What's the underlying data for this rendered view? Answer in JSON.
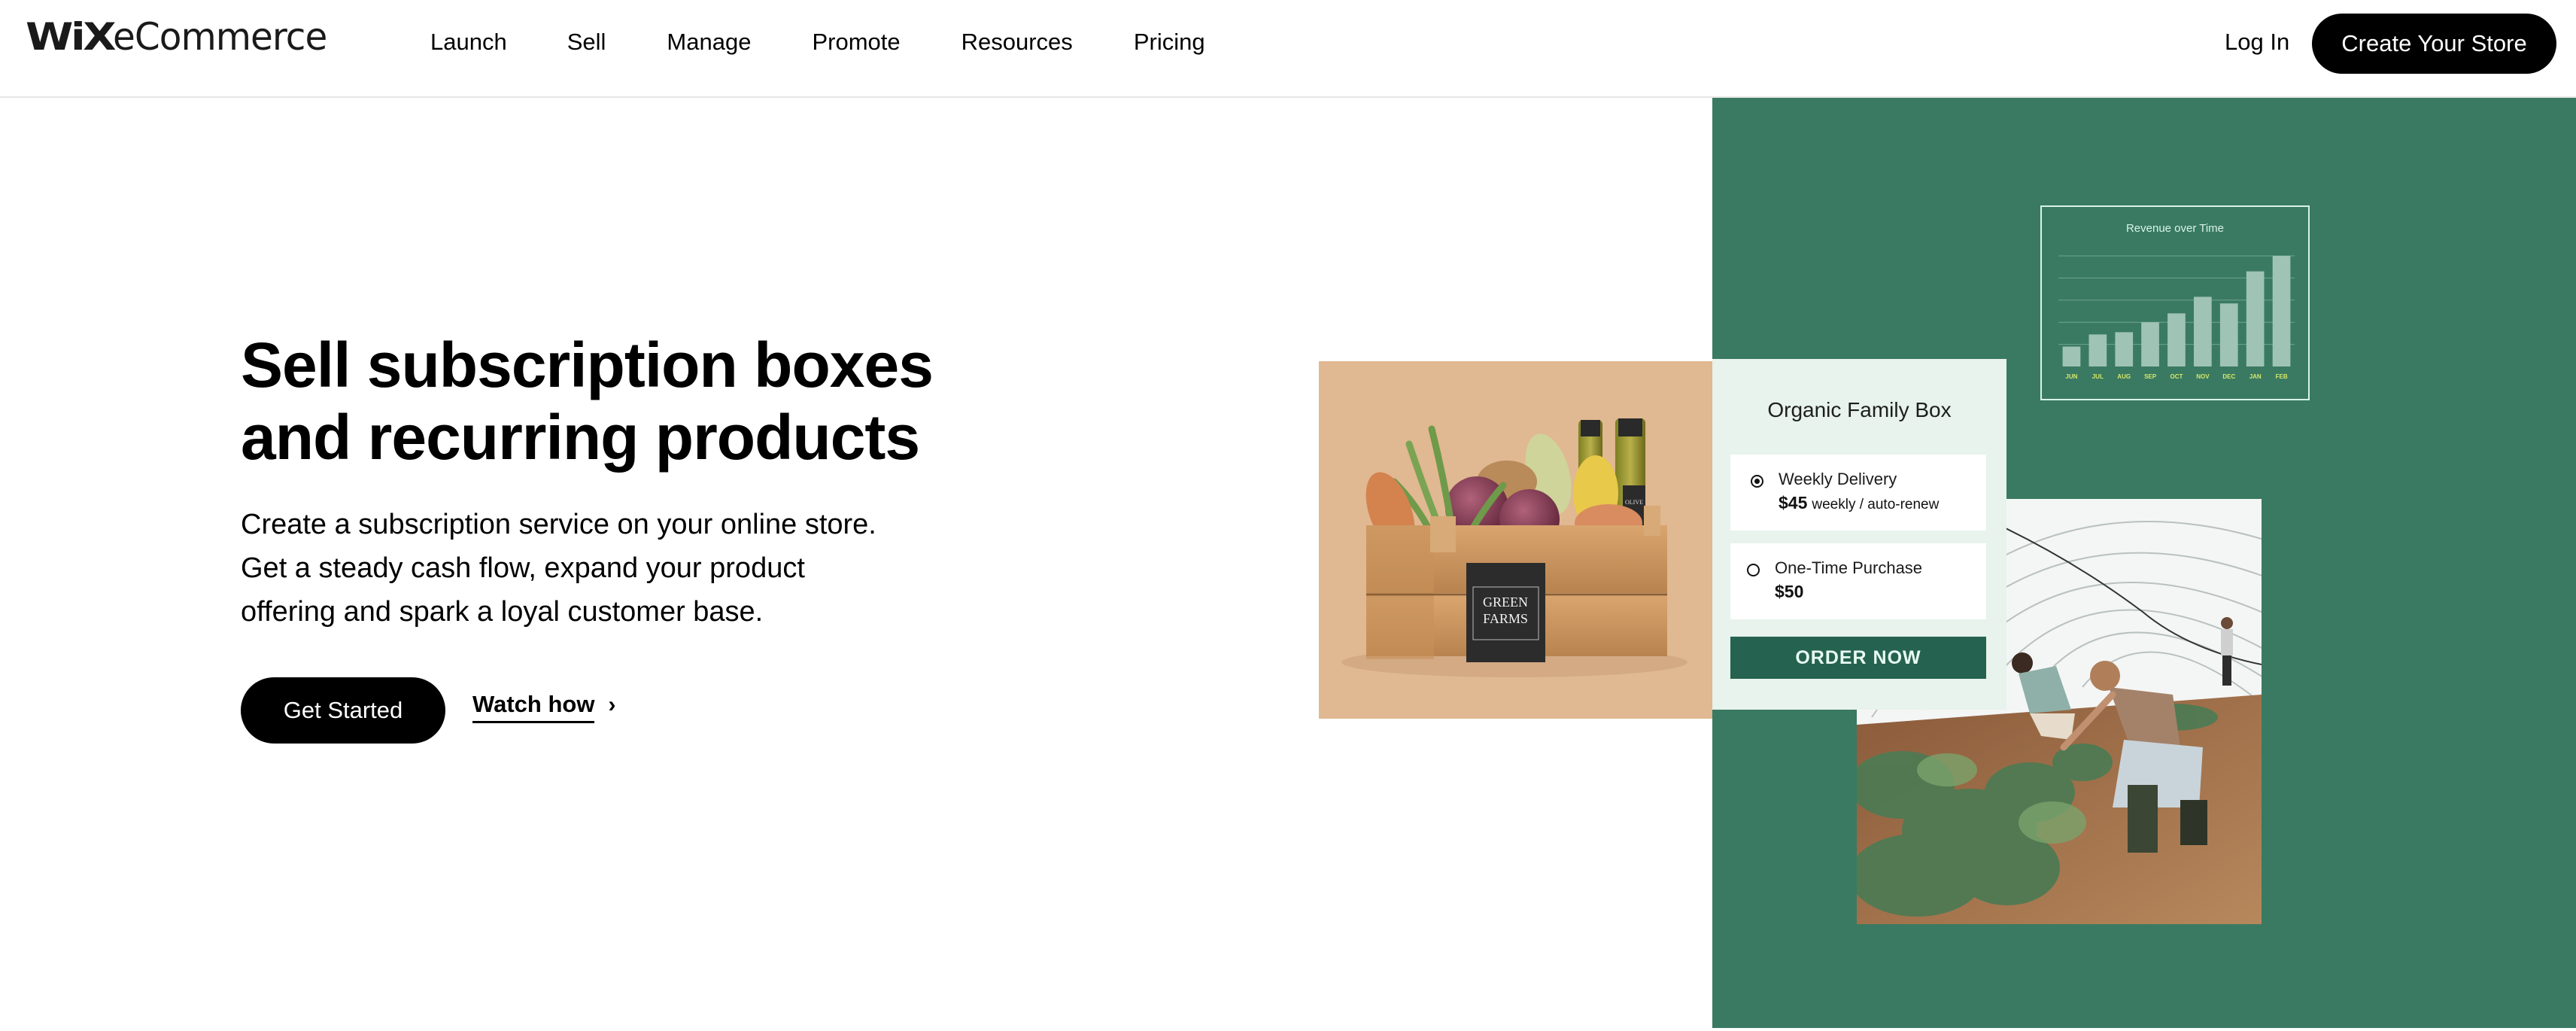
{
  "header": {
    "logo": {
      "brand": "WiX",
      "product": "eCommerce"
    },
    "nav": [
      {
        "label": "Launch"
      },
      {
        "label": "Sell"
      },
      {
        "label": "Manage"
      },
      {
        "label": "Promote"
      },
      {
        "label": "Resources"
      },
      {
        "label": "Pricing"
      }
    ],
    "login_label": "Log In",
    "cta_label": "Create Your Store"
  },
  "hero": {
    "title_lines": [
      "Sell subscription boxes",
      "and recurring products"
    ],
    "description_lines": [
      "Create a subscription service on your online store.",
      "Get a steady cash flow, expand your product",
      "offering and spark a loyal customer base."
    ],
    "primary_button": "Get Started",
    "secondary_link": "Watch how",
    "secondary_icon": "chevron-right-icon"
  },
  "colors": {
    "panel_green": "#3a7a62",
    "button_green": "#256250",
    "card_bg": "#e7f3ec",
    "crate_bg": "#e0b891",
    "chart_bar": "#9fc3b4",
    "chart_label": "#d6e86a",
    "chart_title": "#d8f3ea"
  },
  "chart_data": {
    "type": "bar",
    "title": "Revenue over Time",
    "categories": [
      "JUN",
      "JUL",
      "AUG",
      "SEP",
      "OCT",
      "NOV",
      "DEC",
      "JAN",
      "FEB"
    ],
    "values": [
      18,
      29,
      31,
      40,
      48,
      63,
      57,
      86,
      100
    ],
    "xlabel": "",
    "ylabel": "",
    "ylim": [
      0,
      100
    ],
    "gridlines": [
      20,
      40,
      60,
      80,
      100
    ],
    "grid": true,
    "legend": "none"
  },
  "product_image": {
    "alt": "Wooden crate of organic vegetables",
    "label_line1": "GREEN",
    "label_line2": "FARMS",
    "bottle_label": "OLIVE"
  },
  "product_card": {
    "title": "Organic Family Box",
    "options": [
      {
        "name": "Weekly Delivery",
        "price": "$45",
        "price_note": "weekly / auto-renew",
        "selected": true
      },
      {
        "name": "One-Time Purchase",
        "price": "$50",
        "price_note": "",
        "selected": false
      }
    ],
    "order_button": "ORDER NOW"
  },
  "farm_image": {
    "alt": "Farmers harvesting in a greenhouse"
  }
}
